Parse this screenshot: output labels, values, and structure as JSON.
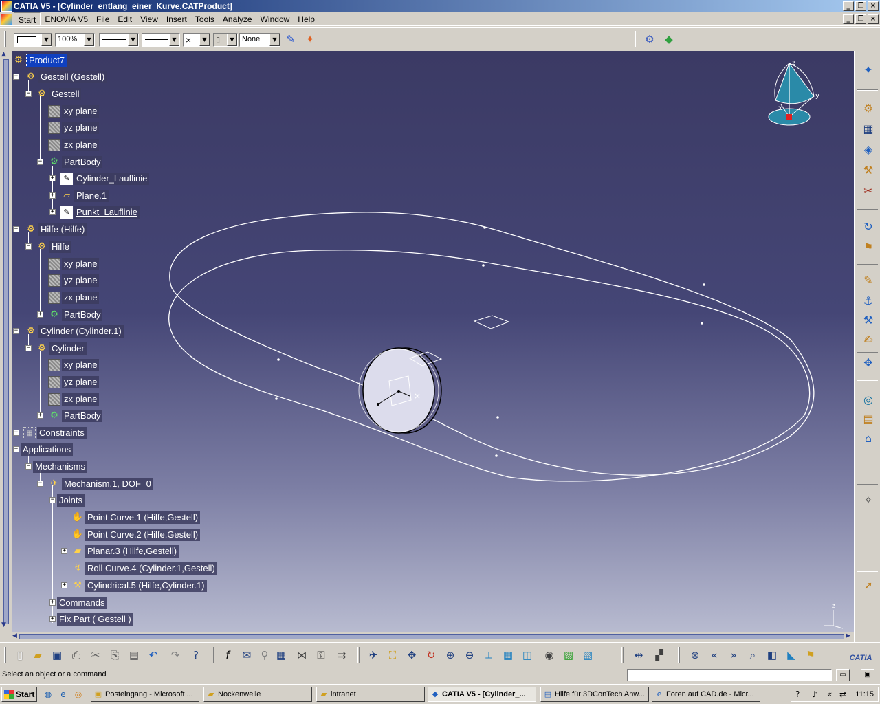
{
  "window": {
    "title": "CATIA V5 - [Cylinder_entlang_einer_Kurve.CATProduct]"
  },
  "menu": [
    "Start",
    "ENOVIA V5",
    "File",
    "Edit",
    "View",
    "Insert",
    "Tools",
    "Analyze",
    "Window",
    "Help"
  ],
  "toolbar_top": {
    "zoom_value": "100%",
    "render_value": "None"
  },
  "tree": {
    "product": "Product7",
    "gestell_instance": "Gestell (Gestell)",
    "gestell_part": "Gestell",
    "xy_plane": "xy plane",
    "yz_plane": "yz plane",
    "zx_plane": "zx plane",
    "partbody": "PartBody",
    "cylinder_laufline": "Cylinder_Lauflinie",
    "plane1": "Plane.1",
    "punkt_laufline": "Punkt_Lauflinie",
    "hilfe_instance": "Hilfe (Hilfe)",
    "hilfe_part": "Hilfe",
    "cylinder_instance": "Cylinder (Cylinder.1)",
    "cylinder_part": "Cylinder",
    "constraints": "Constraints",
    "applications": "Applications",
    "mechanisms": "Mechanisms",
    "mechanism1": "Mechanism.1, DOF=0",
    "joints": "Joints",
    "joint1": "Point Curve.1 (Hilfe,Gestell)",
    "joint2": "Point Curve.2 (Hilfe,Gestell)",
    "joint3": "Planar.3 (Hilfe,Gestell)",
    "joint4": "Roll Curve.4 (Cylinder.1,Gestell)",
    "joint5": "Cylindrical.5 (Hilfe,Cylinder.1)",
    "commands": "Commands",
    "fixpart": "Fix Part ( Gestell )"
  },
  "compass": {
    "z_label": "z",
    "y_label": "y",
    "x_label": "x"
  },
  "axis_corner": {
    "z_label": "z"
  },
  "status": {
    "message": "Select an object or a command"
  },
  "taskbar": {
    "start": "Start",
    "tasks": [
      "Posteingang - Microsoft ...",
      "Nockenwelle",
      "intranet",
      "CATIA V5 - [Cylinder_...",
      "Hilfe für 3DConTech Anw...",
      "Foren auf CAD.de - Micr..."
    ],
    "clock": "11:15"
  },
  "colors": {
    "titlebar": "#0a246a",
    "viewport_top": "#3b3a64",
    "viewport_bottom": "#b8bbd0",
    "tree_selection": "#1040c0"
  }
}
